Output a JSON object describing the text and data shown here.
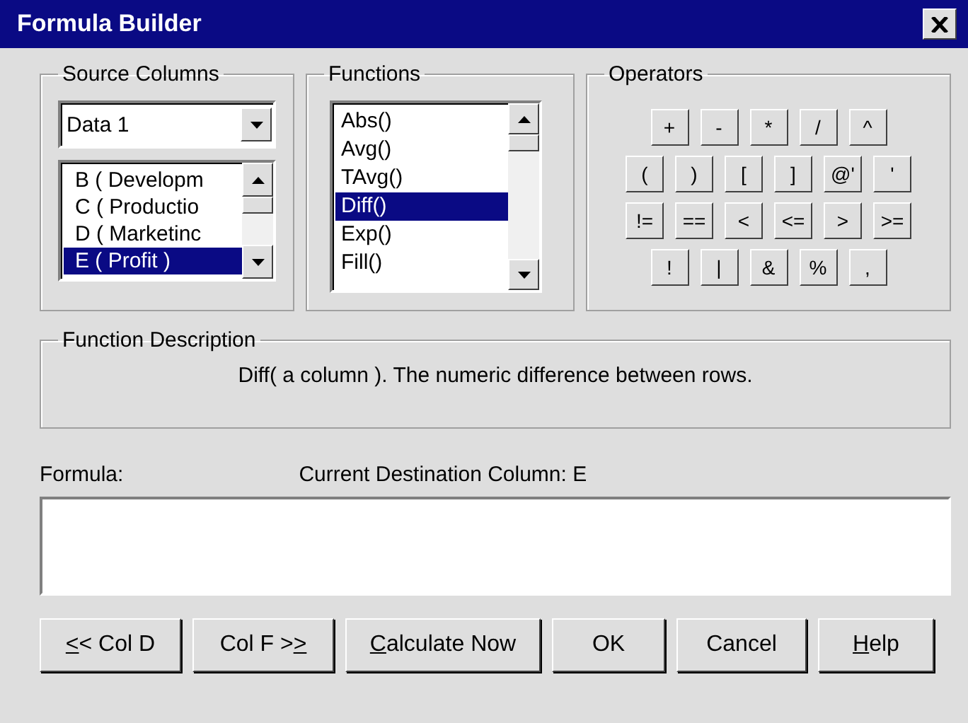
{
  "window": {
    "title": "Formula Builder"
  },
  "source_columns": {
    "legend": "Source Columns",
    "dropdown_value": "Data 1",
    "items": [
      {
        "label": "B ( Developm",
        "selected": false
      },
      {
        "label": "C ( Productio",
        "selected": false
      },
      {
        "label": "D ( Marketinc",
        "selected": false
      },
      {
        "label": "E ( Profit )",
        "selected": true
      }
    ]
  },
  "functions": {
    "legend": "Functions",
    "items": [
      {
        "label": "Abs()",
        "selected": false
      },
      {
        "label": "Avg()",
        "selected": false
      },
      {
        "label": "TAvg()",
        "selected": false
      },
      {
        "label": "Diff()",
        "selected": true
      },
      {
        "label": "Exp()",
        "selected": false
      },
      {
        "label": "Fill()",
        "selected": false
      }
    ]
  },
  "operators": {
    "legend": "Operators",
    "rows": [
      [
        "+",
        "-",
        "*",
        "/",
        "^"
      ],
      [
        "(",
        ")",
        "[",
        "]",
        "@'",
        "'"
      ],
      [
        "!=",
        "==",
        "<",
        "<=",
        ">",
        ">="
      ],
      [
        "!",
        "|",
        "&",
        "%",
        ","
      ]
    ]
  },
  "function_description": {
    "legend": "Function Description",
    "text": "Diff( a column ). The numeric difference between rows."
  },
  "formula": {
    "label": "Formula:",
    "destination": "Current Destination Column: E"
  },
  "buttons": [
    {
      "key": "<",
      "post": "< Col D"
    },
    {
      "pre": "Col F >",
      "key": ">"
    },
    {
      "key": "C",
      "post": "alculate Now"
    },
    {
      "pre": "OK"
    },
    {
      "pre": "Cancel"
    },
    {
      "key": "H",
      "post": "elp"
    }
  ]
}
